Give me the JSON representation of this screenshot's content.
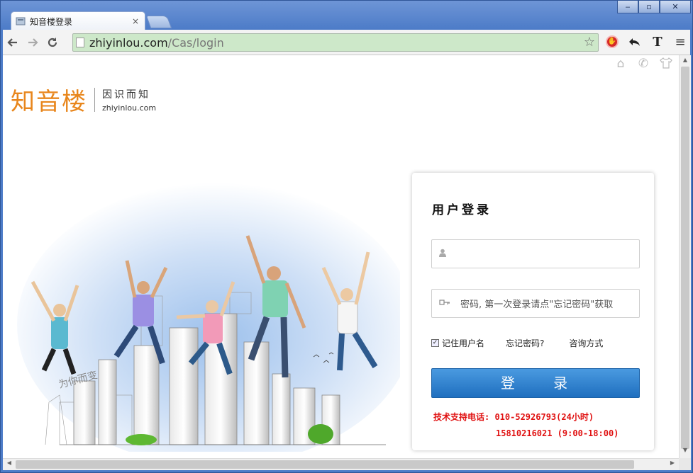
{
  "browser": {
    "tab_title": "知音楼登录",
    "tab_close": "×",
    "url_host": "zhiyinlou.com",
    "url_path": "/Cas/login",
    "window_controls": [
      "‒",
      "▫",
      "✕"
    ]
  },
  "page": {
    "logo": {
      "name": "知音楼",
      "slogan": "因识而知",
      "domain": "zhiyinlou.com"
    },
    "login": {
      "title": "用户登录",
      "username_placeholder": "",
      "password_placeholder": "密码, 第一次登录请点\"忘记密码\"获取",
      "remember_label": "记住用户名",
      "remember_checked": true,
      "forgot_label": "忘记密码?",
      "contact_label": "咨询方式",
      "submit_label": "登 录",
      "support_line1": "技术支持电话: 010-52926793(24小时)",
      "support_line2": "15810216021 (9:00-18:00)"
    },
    "illustration_text": "为你而变"
  },
  "colors": {
    "brand_orange": "#e8861c",
    "button_blue": "#1f6fbf",
    "support_red": "#e01010",
    "omnibox_green": "#cde8c9"
  }
}
